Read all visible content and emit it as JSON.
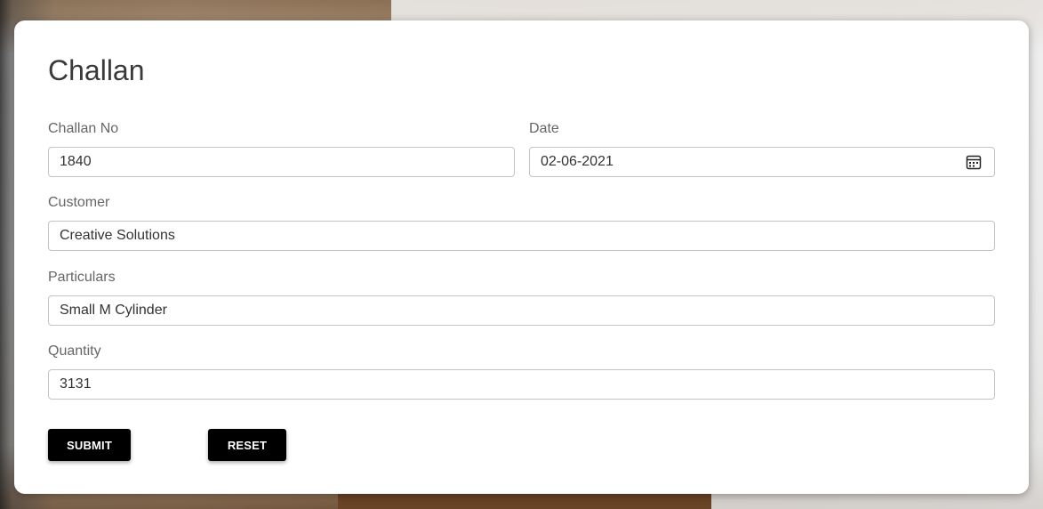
{
  "form": {
    "title": "Challan",
    "fields": {
      "challan_no": {
        "label": "Challan No",
        "value": "1840"
      },
      "date": {
        "label": "Date",
        "value": "02-06-2021",
        "icon": "calendar-icon"
      },
      "customer": {
        "label": "Customer",
        "value": "Creative Solutions"
      },
      "particulars": {
        "label": "Particulars",
        "value": "Small M Cylinder"
      },
      "quantity": {
        "label": "Quantity",
        "value": "3131"
      }
    },
    "buttons": {
      "submit": "SUBMIT",
      "reset": "RESET"
    }
  },
  "colors": {
    "button_bg": "#000000",
    "button_text": "#ffffff",
    "field_border": "#c4c4c4",
    "label": "#666666"
  }
}
